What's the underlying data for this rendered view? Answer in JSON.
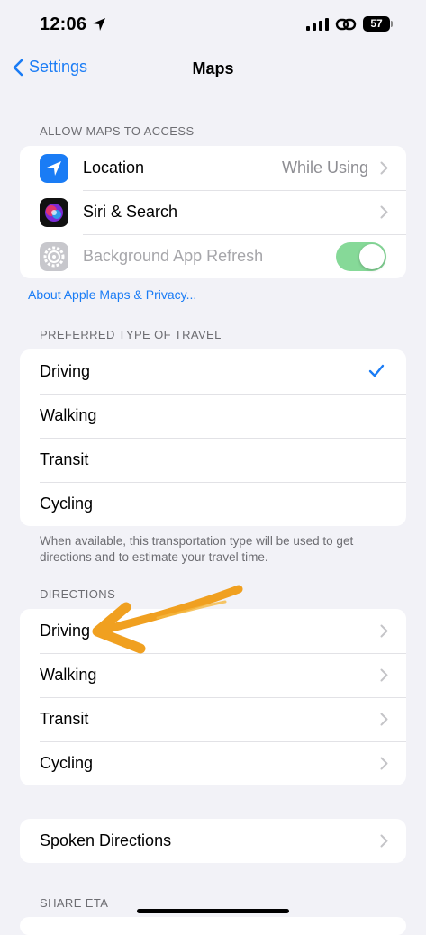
{
  "status": {
    "time": "12:06",
    "battery": "57"
  },
  "nav": {
    "back_label": "Settings",
    "title": "Maps"
  },
  "access": {
    "header": "ALLOW MAPS TO ACCESS",
    "rows": [
      {
        "label": "Location",
        "value": "While Using"
      },
      {
        "label": "Siri & Search"
      },
      {
        "label": "Background App Refresh",
        "toggle": true
      }
    ],
    "footer_link": "About Apple Maps & Privacy..."
  },
  "travel": {
    "header": "PREFERRED TYPE OF TRAVEL",
    "options": [
      "Driving",
      "Walking",
      "Transit",
      "Cycling"
    ],
    "selected": "Driving",
    "footnote": "When available, this transportation type will be used to get directions and to estimate your travel time."
  },
  "directions": {
    "header": "DIRECTIONS",
    "items": [
      "Driving",
      "Walking",
      "Transit",
      "Cycling"
    ]
  },
  "spoken": {
    "label": "Spoken Directions"
  },
  "share_eta": {
    "header": "SHARE ETA"
  },
  "colors": {
    "accent": "#1a7cf5",
    "toggle_on": "#86d998",
    "annotation_arrow": "#f0a020"
  }
}
